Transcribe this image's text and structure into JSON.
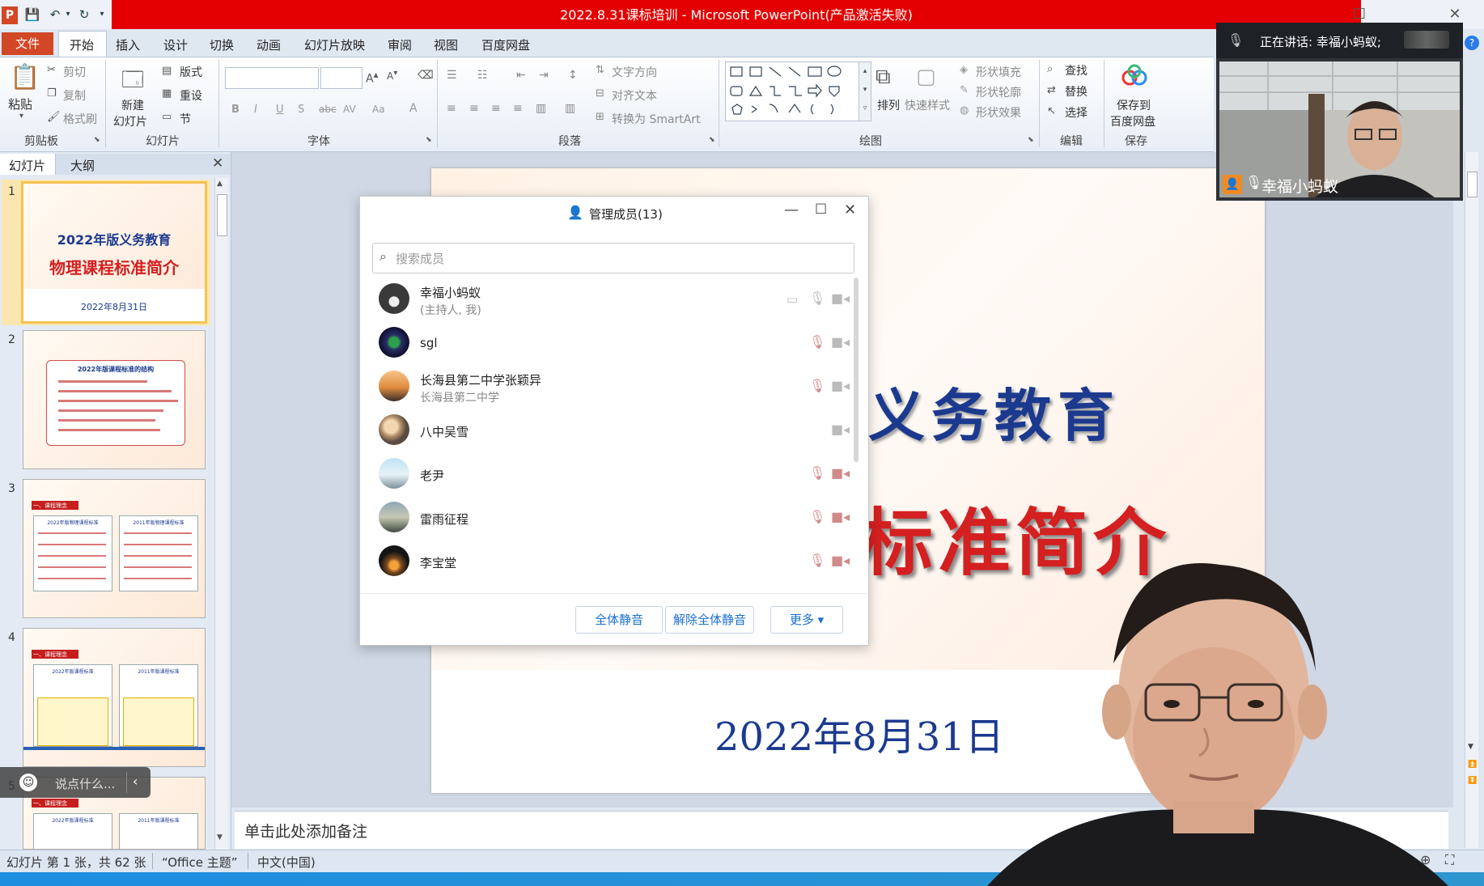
{
  "window": {
    "title": "2022.8.31课标培训 - Microsoft PowerPoint(产品激活失败)",
    "logo_letter": "P"
  },
  "tabs": [
    "文件",
    "开始",
    "插入",
    "设计",
    "切换",
    "动画",
    "幻灯片放映",
    "审阅",
    "视图",
    "百度网盘"
  ],
  "ribbon": {
    "clipboard": {
      "paste": "粘贴",
      "cut": "剪切",
      "copy": "复制",
      "format_painter": "格式刷",
      "label": "剪贴板"
    },
    "slides": {
      "new_slide_1": "新建",
      "new_slide_2": "幻灯片",
      "layout": "版式",
      "reset": "重设",
      "section": "节",
      "label": "幻灯片"
    },
    "font": {
      "label": "字体"
    },
    "paragraph": {
      "text_direction": "文字方向",
      "align_text": "对齐文本",
      "smartart": "转换为 SmartArt",
      "label": "段落"
    },
    "drawing": {
      "arrange": "排列",
      "quick_styles": "快速样式",
      "shape_fill": "形状填充",
      "shape_outline": "形状轮廓",
      "shape_effects": "形状效果",
      "label": "绘图"
    },
    "editing": {
      "find": "查找",
      "replace": "替换",
      "select": "选择",
      "label": "编辑"
    },
    "save": {
      "save_1": "保存到",
      "save_2": "百度网盘",
      "label": "保存"
    }
  },
  "left_panel": {
    "tabs": [
      "幻灯片",
      "大纲"
    ],
    "slide1": {
      "title1": "2022年版义务教育",
      "title2": "物理课程标准简介",
      "date": "2022年8月31日"
    },
    "slide2": {
      "title": "2022年版课程标准的结构"
    },
    "slide3": {
      "hdr": "一、课程理念",
      "col1": "2022年版物理课程标准",
      "col2": "2011年版物理课程标准"
    },
    "slide4": {
      "hdr": "一、课程理念",
      "col1": "2022年版课程标准",
      "col2": "2011年版课程标准"
    },
    "slide5": {
      "hdr": "一、课程理念",
      "col1": "2022年版课程标准",
      "col2": "2011年版课程标准"
    },
    "slide_numbers": [
      "1",
      "2",
      "3",
      "4",
      "5"
    ]
  },
  "slide": {
    "title1": "义务教育",
    "title2": "标准简介",
    "date": "2022年8月31日"
  },
  "notes_placeholder": "单击此处添加备注",
  "status_bar": {
    "slide_info": "幻灯片 第 1 张，共 62 张",
    "theme": "“Office 主题”",
    "language": "中文(中国)"
  },
  "chat": {
    "placeholder": "说点什么..."
  },
  "dialog": {
    "title": "管理成员(13)",
    "search_placeholder": "搜索成员",
    "members": [
      {
        "name": "幸福小蚂蚁",
        "sub": "(主持人, 我)"
      },
      {
        "name": "sgl",
        "sub": ""
      },
      {
        "name": "长海县第二中学张颖异",
        "sub": "长海县第二中学"
      },
      {
        "name": "八中吴雪",
        "sub": ""
      },
      {
        "name": "老尹",
        "sub": ""
      },
      {
        "name": "雷雨征程",
        "sub": ""
      },
      {
        "name": "李宝堂",
        "sub": ""
      }
    ],
    "buttons": {
      "mute_all": "全体静音",
      "unmute_all": "解除全体静音",
      "more": "更多 ▾"
    }
  },
  "speaking": {
    "status": "正在讲话: 幸福小蚂蚁;",
    "speaker": "幸福小蚂蚁"
  }
}
